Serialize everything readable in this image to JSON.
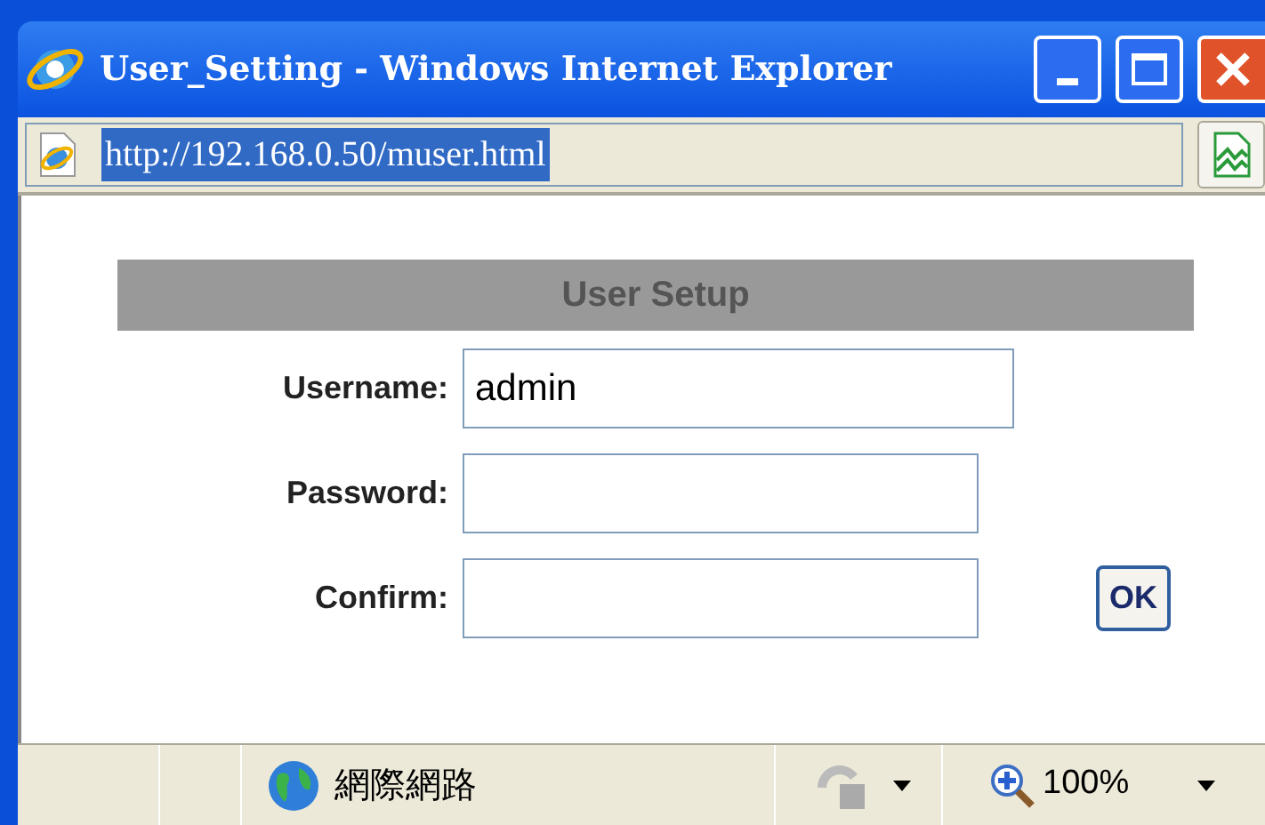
{
  "window": {
    "title": "User_Setting - Windows Internet Explorer"
  },
  "address_bar": {
    "url": "http://192.168.0.50/muser.html"
  },
  "form": {
    "heading": "User Setup",
    "fields": [
      {
        "label": "Username:",
        "value": "admin"
      },
      {
        "label": "Password:"
      },
      {
        "label": "Confirm:"
      }
    ],
    "button": "OK"
  },
  "status_bar": {
    "zone": "網際網路",
    "zoom": "100%"
  }
}
